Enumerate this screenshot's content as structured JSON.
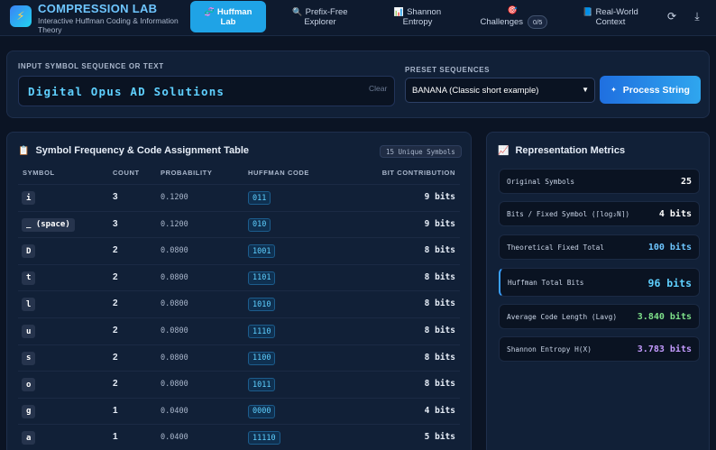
{
  "app": {
    "title": "COMPRESSION LAB",
    "subtitle": "Interactive Huffman Coding & Information Theory",
    "logo_icon": "lightning-icon"
  },
  "nav": [
    {
      "icon": "🧬",
      "line1": "Huffman",
      "line2": "Lab",
      "active": true
    },
    {
      "icon": "🔍",
      "line1": "Prefix-Free",
      "line2": "Explorer",
      "active": false
    },
    {
      "icon": "📊",
      "line1": "Shannon",
      "line2": "Entropy",
      "active": false
    },
    {
      "icon": "🎯",
      "line1": "Challenges",
      "line2": "",
      "badge": "0/5",
      "active": false
    },
    {
      "icon": "📘",
      "line1": "Real-World",
      "line2": "Context",
      "active": false
    }
  ],
  "header_actions": {
    "refresh_icon": "⟳",
    "download_icon": "⤓"
  },
  "input": {
    "label": "INPUT SYMBOL SEQUENCE OR TEXT",
    "value": "Digital Opus AD Solutions",
    "clear_label": "Clear"
  },
  "presets": {
    "label": "PRESET SEQUENCES",
    "selected": "BANANA (Classic short example)"
  },
  "process_button": {
    "icon": "✦",
    "label": "Process String"
  },
  "table": {
    "icon": "📋",
    "title": "Symbol Frequency & Code Assignment Table",
    "badge": "15 Unique Symbols",
    "headers": {
      "symbol": "SYMBOL",
      "count": "COUNT",
      "probability": "PROBABILITY",
      "code": "HUFFMAN CODE",
      "bits": "BIT CONTRIBUTION"
    },
    "rows": [
      {
        "symbol": "i",
        "count": "3",
        "probability": "0.1200",
        "code": "011",
        "bits": "9 bits"
      },
      {
        "symbol": "_ (space)",
        "count": "3",
        "probability": "0.1200",
        "code": "010",
        "bits": "9 bits"
      },
      {
        "symbol": "D",
        "count": "2",
        "probability": "0.0800",
        "code": "1001",
        "bits": "8 bits"
      },
      {
        "symbol": "t",
        "count": "2",
        "probability": "0.0800",
        "code": "1101",
        "bits": "8 bits"
      },
      {
        "symbol": "l",
        "count": "2",
        "probability": "0.0800",
        "code": "1010",
        "bits": "8 bits"
      },
      {
        "symbol": "u",
        "count": "2",
        "probability": "0.0800",
        "code": "1110",
        "bits": "8 bits"
      },
      {
        "symbol": "s",
        "count": "2",
        "probability": "0.0800",
        "code": "1100",
        "bits": "8 bits"
      },
      {
        "symbol": "o",
        "count": "2",
        "probability": "0.0800",
        "code": "1011",
        "bits": "8 bits"
      },
      {
        "symbol": "g",
        "count": "1",
        "probability": "0.0400",
        "code": "0000",
        "bits": "4 bits"
      },
      {
        "symbol": "a",
        "count": "1",
        "probability": "0.0400",
        "code": "11110",
        "bits": "5 bits"
      }
    ]
  },
  "metrics": {
    "icon": "📈",
    "title": "Representation Metrics",
    "items": [
      {
        "label": "Original Symbols",
        "value": "25",
        "color": "#ffffff",
        "highlight": false
      },
      {
        "label": "Bits / Fixed Symbol (⌈log₂N⌉)",
        "value": "4 bits",
        "color": "#ffffff",
        "highlight": false
      },
      {
        "label": "Theoretical Fixed Total",
        "value": "100 bits",
        "color": "#6ec6ff",
        "highlight": false
      },
      {
        "label": "Huffman Total Bits",
        "value": "96 bits",
        "color": "#5fd0ff",
        "highlight": true
      },
      {
        "label": "Average Code Length (Lavg)",
        "value": "3.840 bits",
        "color": "#7ee08a",
        "highlight": false
      },
      {
        "label": "Shannon Entropy H(X)",
        "value": "3.783 bits",
        "color": "#c49bff",
        "highlight": false
      }
    ]
  }
}
